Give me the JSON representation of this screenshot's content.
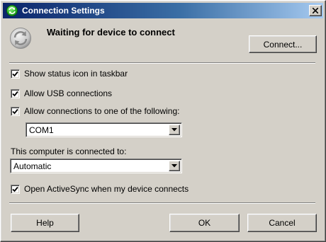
{
  "window": {
    "title": "Connection Settings",
    "colors": {
      "titlebar_start": "#0a246a",
      "titlebar_end": "#a6caf0",
      "face": "#d4d0c8"
    },
    "icons": {
      "app": "activesync-icon",
      "close": "close-icon",
      "status": "sync-status-icon"
    }
  },
  "status": {
    "heading": "Waiting for device to connect",
    "connect_label": "Connect..."
  },
  "options": {
    "show_status_icon": {
      "label": "Show status icon in taskbar",
      "checked": true
    },
    "allow_usb": {
      "label": "Allow USB connections",
      "checked": true
    },
    "allow_connections": {
      "label": "Allow connections to one of the following:",
      "checked": true
    },
    "port_select": {
      "value": "COM1"
    },
    "computer_connected_label": "This computer is connected to:",
    "connection_type_select": {
      "value": "Automatic"
    },
    "open_activesync": {
      "label": "Open ActiveSync when my device connects",
      "checked": true
    }
  },
  "footer": {
    "help_label": "Help",
    "ok_label": "OK",
    "cancel_label": "Cancel"
  }
}
